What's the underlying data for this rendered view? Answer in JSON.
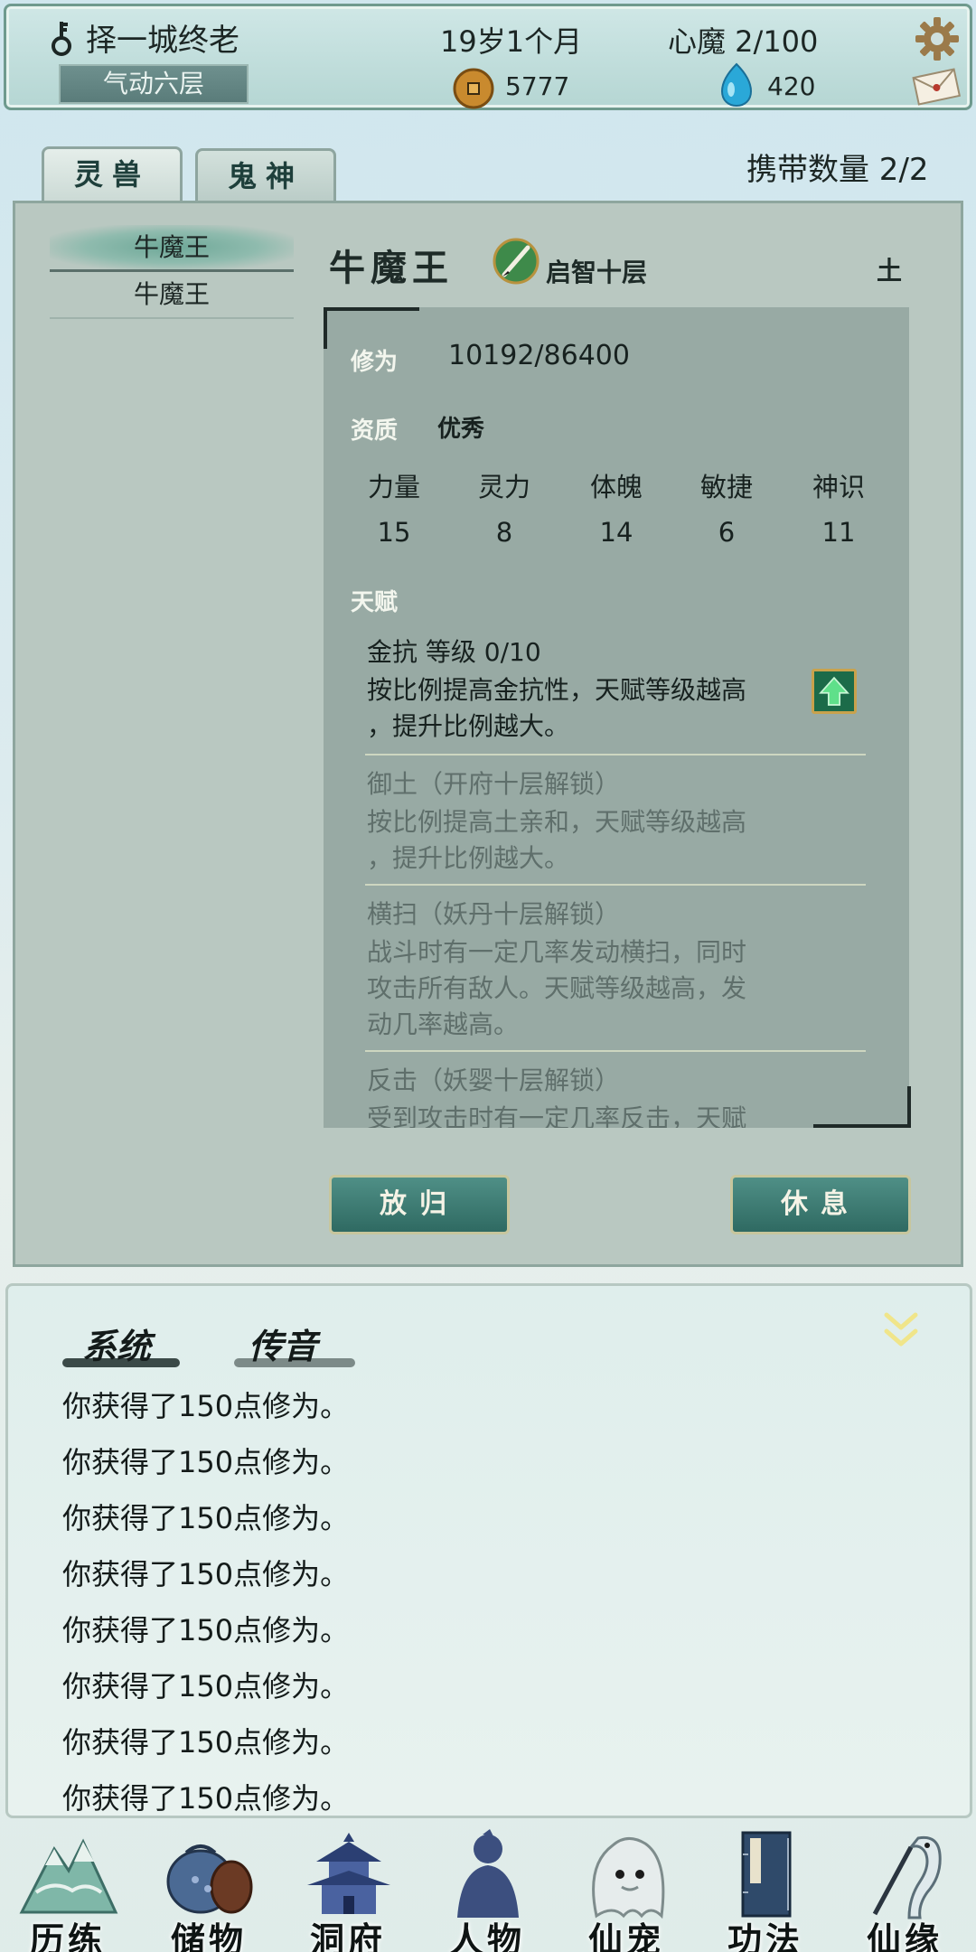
{
  "status": {
    "player_name": "择一城终老",
    "realm": "气动六层",
    "age": "19岁1个月",
    "heart_demon": "心魔  2/100",
    "coins": "5777",
    "spirit_stones": "420"
  },
  "tabs": [
    {
      "label": "灵兽",
      "active": true
    },
    {
      "label": "鬼神",
      "active": false
    }
  ],
  "carry": "携带数量   2/2",
  "pet_list": [
    {
      "label": "牛魔王",
      "selected": true
    },
    {
      "label": "牛魔王",
      "selected": false
    }
  ],
  "pet": {
    "name": "牛魔王",
    "stage": "启智十层",
    "element": "土",
    "xiuwei_label": "修为",
    "xiuwei_value": "10192/86400",
    "zizhi_label": "资质",
    "zizhi_value": "优秀",
    "attributes": [
      {
        "label": "力量",
        "value": "15"
      },
      {
        "label": "灵力",
        "value": "8"
      },
      {
        "label": "体魄",
        "value": "14"
      },
      {
        "label": "敏捷",
        "value": "6"
      },
      {
        "label": "神识",
        "value": "11"
      }
    ],
    "tianfu_label": "天赋",
    "talents": [
      {
        "name": "金抗   等级  0/10",
        "desc1": "按比例提高金抗性，天赋等级越高",
        "desc2": "，提升比例越大。",
        "locked": false
      },
      {
        "name": "御土（开府十层解锁）",
        "desc1": "按比例提高土亲和，天赋等级越高",
        "desc2": "，提升比例越大。",
        "locked": true
      },
      {
        "name": "横扫（妖丹十层解锁）",
        "desc1": "战斗时有一定几率发动横扫，同时",
        "desc2": "攻击所有敌人。天赋等级越高，发",
        "desc3": "动几率越高。",
        "locked": true
      },
      {
        "name": "反击（妖婴十层解锁）",
        "desc1": "受到攻击时有一定几率反击，天赋",
        "locked": true
      }
    ]
  },
  "buttons": {
    "release": "放归",
    "rest": "休息"
  },
  "log": {
    "tabs": [
      "系统",
      "传音"
    ],
    "lines": [
      "你获得了150点修为。",
      "你获得了150点修为。",
      "你获得了150点修为。",
      "你获得了150点修为。",
      "你获得了150点修为。",
      "你获得了150点修为。",
      "你获得了150点修为。",
      "你获得了150点修为。"
    ]
  },
  "nav": [
    {
      "label": "历练",
      "icon": "mountain-icon"
    },
    {
      "label": "储物",
      "icon": "pouch-icon"
    },
    {
      "label": "洞府",
      "icon": "pagoda-icon"
    },
    {
      "label": "人物",
      "icon": "person-icon"
    },
    {
      "label": "仙宠",
      "icon": "ghost-pet-icon"
    },
    {
      "label": "功法",
      "icon": "book-icon"
    },
    {
      "label": "仙缘",
      "icon": "crane-icon"
    }
  ]
}
